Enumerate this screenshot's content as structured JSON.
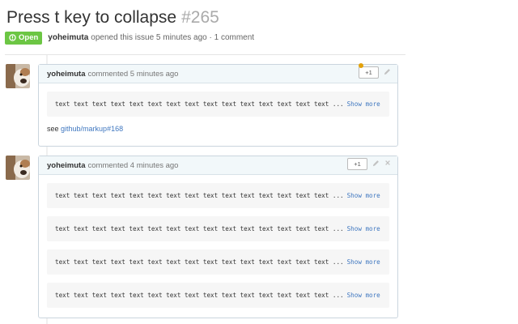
{
  "issue": {
    "title": "Press t key to collapse",
    "number": "#265",
    "state_label": "Open",
    "author": "yoheimuta",
    "opened_text": "opened this issue 5 minutes ago · 1 comment"
  },
  "comments": [
    {
      "author": "yoheimuta",
      "time": "commented 5 minutes ago",
      "plus_label": "+1",
      "code_text": "text text text text text text text text text text text text text text text ...",
      "show_more": "Show more",
      "see_prefix": "see",
      "see_link": "github/markup#168"
    },
    {
      "author": "yoheimuta",
      "time": "commented 4 minutes ago",
      "plus_label": "+1",
      "blocks": [
        {
          "code_text": "text text text text text text text text text text text text text text text ...",
          "show_more": "Show more"
        },
        {
          "code_text": "text text text text text text text text text text text text text text text ...",
          "show_more": "Show more"
        },
        {
          "code_text": "text text text text text text text text text text text text text text text ...",
          "show_more": "Show more"
        },
        {
          "code_text": "text text text text text text text text text text text text text text text ...",
          "show_more": "Show more"
        }
      ]
    }
  ],
  "icons": {
    "state": "issue-opened-icon",
    "edit": "pencil-icon",
    "delete": "close-icon",
    "notification": "notification-dot"
  },
  "colors": {
    "open": "#6cc644",
    "link": "#4078c0",
    "header_bg": "#f2f8fa",
    "dot": "#e3a10a"
  }
}
